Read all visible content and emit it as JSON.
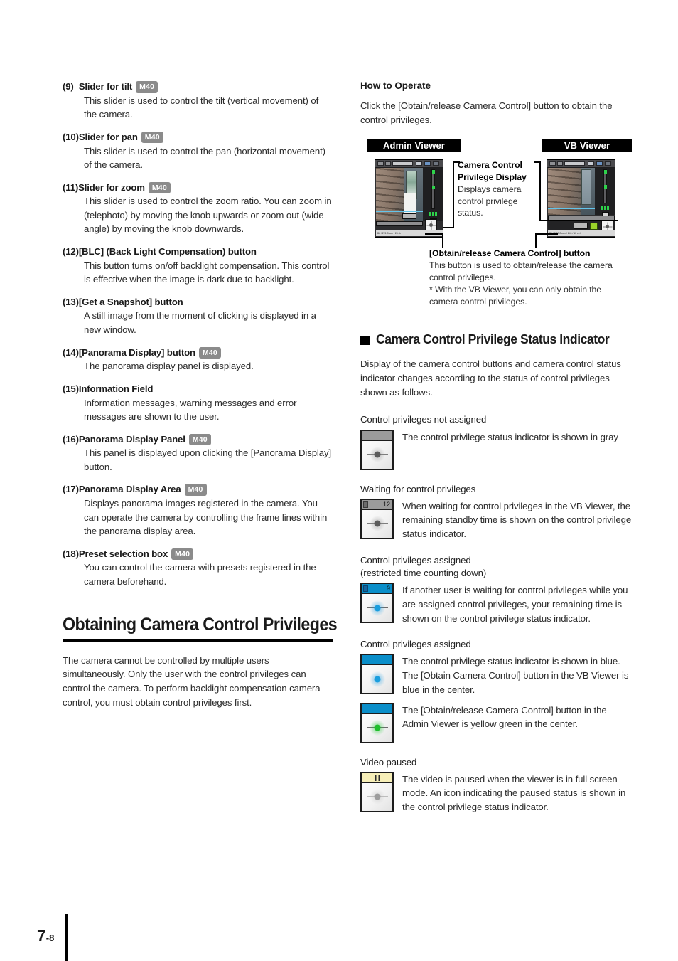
{
  "left_column": {
    "items": [
      {
        "num": "(9)",
        "pad": "  ",
        "title": "Slider for tilt",
        "badge": "M40",
        "body": "This slider is used to control the tilt (vertical movement) of the camera."
      },
      {
        "num": "(10)",
        "pad": "",
        "title": "Slider for pan",
        "badge": "M40",
        "body": "This slider is used to control the pan (horizontal movement) of the camera."
      },
      {
        "num": "(11)",
        "pad": "",
        "title": "Slider for zoom",
        "badge": "M40",
        "body": "This slider is used to control the zoom ratio. You can zoom in (telephoto) by moving the knob upwards or zoom out (wide-angle) by moving the knob downwards."
      },
      {
        "num": "(12)",
        "pad": "",
        "title": "[BLC] (Back Light Compensation) button",
        "badge": "",
        "body": "This button turns on/off backlight compensation. This control is effective when the image is dark due to backlight."
      },
      {
        "num": "(13)",
        "pad": "",
        "title": "[Get a Snapshot] button",
        "badge": "",
        "body": "A still image from the moment of clicking is displayed in a new window."
      },
      {
        "num": "(14)",
        "pad": "",
        "title": "[Panorama Display] button",
        "badge": "M40",
        "body": "The panorama display panel is displayed."
      },
      {
        "num": "(15)",
        "pad": "",
        "title": "Information Field",
        "badge": "",
        "body": "Information messages, warning messages and error messages are shown to the user."
      },
      {
        "num": "(16)",
        "pad": "",
        "title": "Panorama Display Panel",
        "badge": "M40",
        "body": "This panel is displayed upon clicking the [Panorama Display] button."
      },
      {
        "num": "(17)",
        "pad": "",
        "title": "Panorama Display Area",
        "badge": "M40",
        "body": "Displays panorama images registered in the camera. You can operate the camera by controlling the frame lines within the panorama display area."
      },
      {
        "num": "(18)",
        "pad": "",
        "title": "Preset selection box",
        "badge": "M40",
        "body": "You can control the camera with presets registered in the camera beforehand."
      }
    ],
    "chapter_heading": "Obtaining Camera Control Privileges",
    "chapter_paragraph": "The camera cannot be controlled by multiple users simultaneously. Only the user with the control privileges can control the camera. To perform backlight compensation camera control, you must obtain control privileges first."
  },
  "right_column": {
    "how_to_operate": {
      "heading": "How to Operate",
      "paragraph": "Click the [Obtain/release Camera Control] button to obtain the control privileges."
    },
    "viewer_tags": {
      "admin": "Admin Viewer",
      "vb": "VB Viewer"
    },
    "viewer_status_admin": "Bit / 276 Zoom / 24 ch",
    "viewer_status_vb": "Bit / 2 50 Zoom / 24 t / 10 ctrl",
    "callouts": {
      "privilege_display_title": "Camera Control Privilege Display",
      "privilege_display_body": "Displays camera control privilege status.",
      "obtain_title": "[Obtain/release Camera Control] button",
      "obtain_body": "This button is used to obtain/release the camera control privileges.",
      "obtain_note": "* With the VB Viewer, you can only obtain the camera control privileges."
    },
    "section": {
      "title": "Camera Control Privilege Status Indicator",
      "paragraph": "Display of the camera control buttons and camera control status indicator changes according to the status of control privileges shown as follows."
    },
    "statuses": [
      {
        "label": "Control privileges not assigned",
        "bar_color": "gray",
        "bar_count": "",
        "bar_icon": "",
        "cross_style": "gray",
        "text": "The control privilege status indicator is shown in gray"
      },
      {
        "label": "Waiting for control privileges",
        "bar_color": "gray",
        "bar_count": "12",
        "bar_icon": "lock-icon",
        "cross_style": "gray",
        "text": "When waiting for control privileges in the VB Viewer, the remaining standby time is shown on the control privilege status indicator."
      },
      {
        "label": "Control privileges assigned\n(restricted time counting down)",
        "bar_color": "blue",
        "bar_count": "9",
        "bar_icon": "lock-icon",
        "cross_style": "blue",
        "text": "If another user is waiting for control privileges while you are assigned control privileges, your remaining time is shown on the control privilege status indicator."
      },
      {
        "label": "Control privileges assigned",
        "bar_color": "blue",
        "bar_count": "",
        "bar_icon": "",
        "cross_style": "blue",
        "text": "The control privilege status indicator is shown in blue.\nThe [Obtain Camera Control] button in the VB Viewer is blue in the center."
      },
      {
        "label": "",
        "bar_color": "blue",
        "bar_count": "",
        "bar_icon": "",
        "cross_style": "green",
        "text": "The [Obtain/release Camera Control] button in the Admin Viewer is yellow green in the center."
      },
      {
        "label": "Video paused",
        "bar_color": "yellow",
        "bar_count": "",
        "bar_icon": "pause-icon",
        "cross_style": "gray-l",
        "text": "The video is paused when the viewer is in full screen mode. An icon indicating the paused status is shown in the control privilege status indicator."
      }
    ]
  },
  "footer": {
    "chapter": "7",
    "page": "-8"
  },
  "colors": {
    "badge_gray": "#8b8b8b",
    "indicator_gray": "#9b9b9b",
    "indicator_blue": "#0a8ec9",
    "indicator_yellow": "#f7efb8",
    "dot_blue": "#1a9ede",
    "dot_green": "#1fbf2c",
    "text": "#2b2b2b"
  }
}
